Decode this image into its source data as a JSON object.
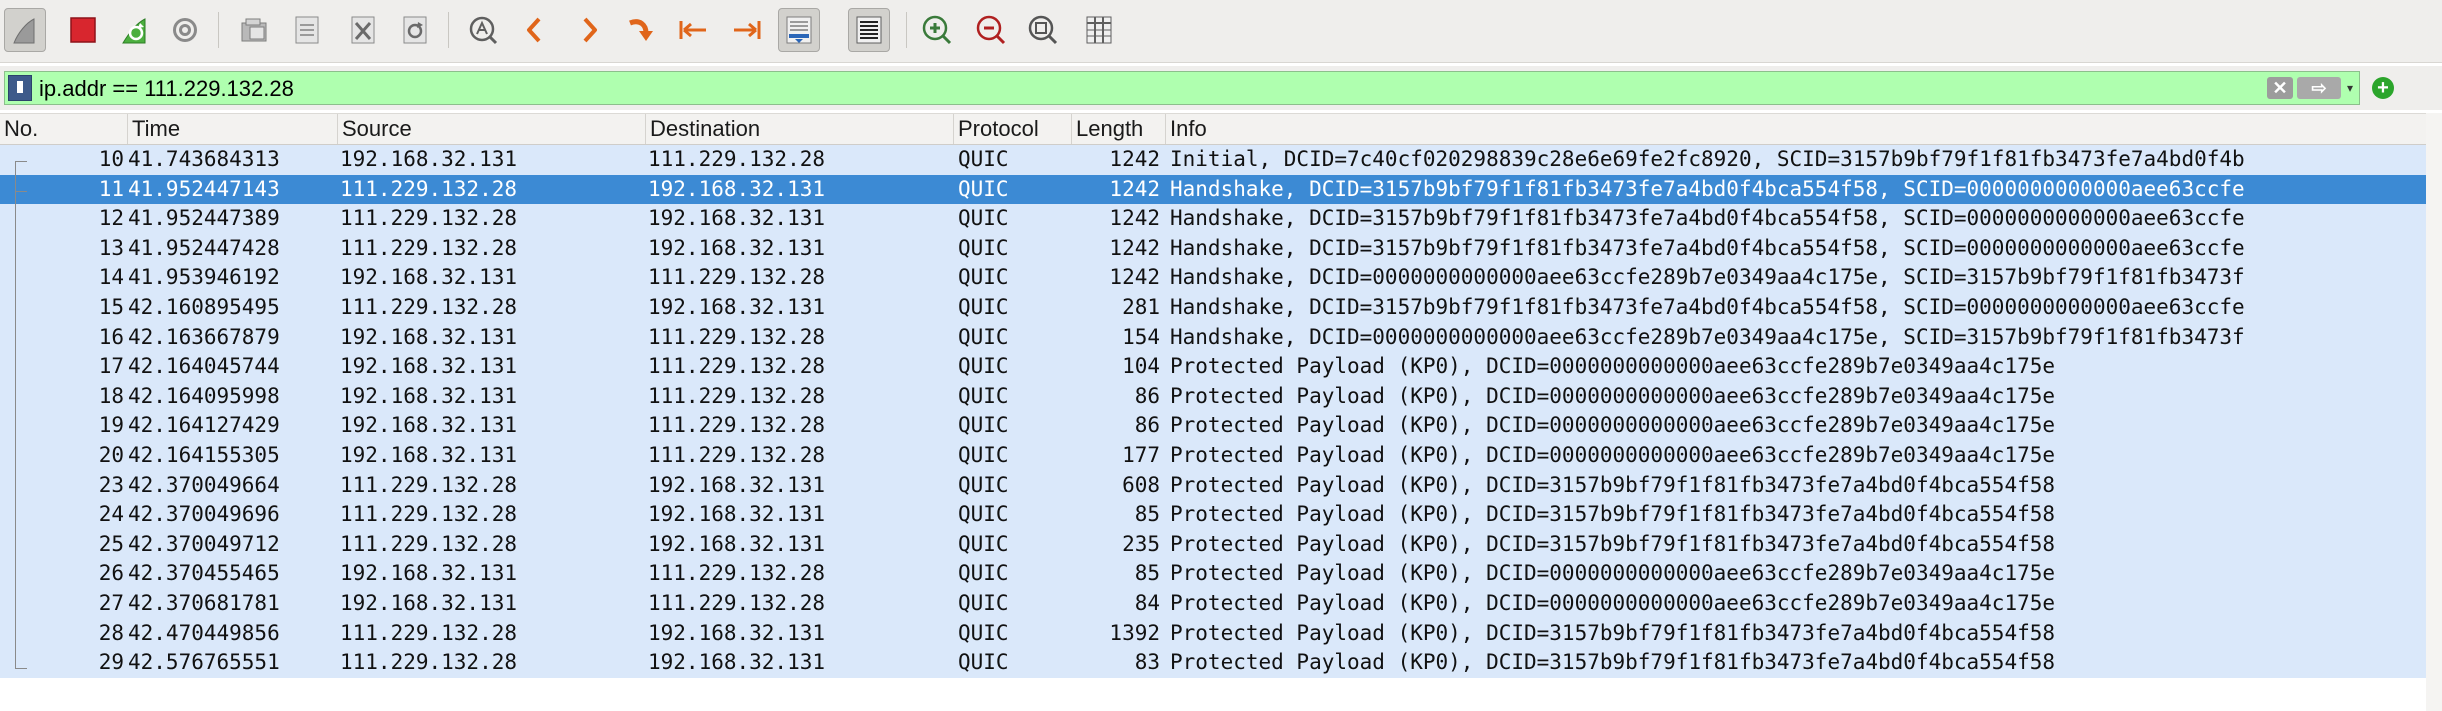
{
  "toolbar": {
    "buttons": [
      {
        "icon": "shark-fin-start-icon"
      },
      {
        "icon": "stop-square-icon"
      },
      {
        "icon": "restart-capture-icon"
      },
      {
        "icon": "capture-options-gear-icon"
      },
      {
        "icon": "open-file-icon"
      },
      {
        "icon": "save-file-icon"
      },
      {
        "icon": "close-file-icon"
      },
      {
        "icon": "reload-file-icon"
      },
      {
        "icon": "find-packet-icon"
      },
      {
        "icon": "go-back-arrow-icon"
      },
      {
        "icon": "go-forward-arrow-icon"
      },
      {
        "icon": "go-to-packet-icon"
      },
      {
        "icon": "go-first-packet-icon"
      },
      {
        "icon": "go-last-packet-icon"
      },
      {
        "icon": "auto-scroll-icon"
      },
      {
        "icon": "colorize-icon"
      },
      {
        "icon": "zoom-in-icon"
      },
      {
        "icon": "zoom-out-icon"
      },
      {
        "icon": "normal-size-icon"
      },
      {
        "icon": "resize-columns-icon"
      }
    ]
  },
  "filter": {
    "value": "ip.addr == 111.229.132.28",
    "clear_label": "✕",
    "apply_label": "⇨",
    "dropdown_label": "▾",
    "add_label": "+",
    "background": "#afffaf"
  },
  "columns": {
    "no": "No.",
    "time": "Time",
    "source": "Source",
    "destination": "Destination",
    "protocol": "Protocol",
    "length": "Length",
    "info": "Info"
  },
  "colors": {
    "row_bg": "#dae8fa",
    "selected_bg": "#3c8ad4"
  },
  "packets": [
    {
      "no": "10",
      "time": "41.743684313",
      "src": "192.168.32.131",
      "dst": "111.229.132.28",
      "proto": "QUIC",
      "len": "1242",
      "info": "Initial, DCID=7c40cf020298839c28e6e69fe2fc8920, SCID=3157b9bf79f1f81fb3473fe7a4bd0f4b",
      "selected": false
    },
    {
      "no": "11",
      "time": "41.952447143",
      "src": "111.229.132.28",
      "dst": "192.168.32.131",
      "proto": "QUIC",
      "len": "1242",
      "info": "Handshake, DCID=3157b9bf79f1f81fb3473fe7a4bd0f4bca554f58, SCID=0000000000000aee63ccfe",
      "selected": true
    },
    {
      "no": "12",
      "time": "41.952447389",
      "src": "111.229.132.28",
      "dst": "192.168.32.131",
      "proto": "QUIC",
      "len": "1242",
      "info": "Handshake, DCID=3157b9bf79f1f81fb3473fe7a4bd0f4bca554f58, SCID=0000000000000aee63ccfe",
      "selected": false
    },
    {
      "no": "13",
      "time": "41.952447428",
      "src": "111.229.132.28",
      "dst": "192.168.32.131",
      "proto": "QUIC",
      "len": "1242",
      "info": "Handshake, DCID=3157b9bf79f1f81fb3473fe7a4bd0f4bca554f58, SCID=0000000000000aee63ccfe",
      "selected": false
    },
    {
      "no": "14",
      "time": "41.953946192",
      "src": "192.168.32.131",
      "dst": "111.229.132.28",
      "proto": "QUIC",
      "len": "1242",
      "info": "Handshake, DCID=0000000000000aee63ccfe289b7e0349aa4c175e, SCID=3157b9bf79f1f81fb3473f",
      "selected": false
    },
    {
      "no": "15",
      "time": "42.160895495",
      "src": "111.229.132.28",
      "dst": "192.168.32.131",
      "proto": "QUIC",
      "len": "281",
      "info": "Handshake, DCID=3157b9bf79f1f81fb3473fe7a4bd0f4bca554f58, SCID=0000000000000aee63ccfe",
      "selected": false
    },
    {
      "no": "16",
      "time": "42.163667879",
      "src": "192.168.32.131",
      "dst": "111.229.132.28",
      "proto": "QUIC",
      "len": "154",
      "info": "Handshake, DCID=0000000000000aee63ccfe289b7e0349aa4c175e, SCID=3157b9bf79f1f81fb3473f",
      "selected": false
    },
    {
      "no": "17",
      "time": "42.164045744",
      "src": "192.168.32.131",
      "dst": "111.229.132.28",
      "proto": "QUIC",
      "len": "104",
      "info": "Protected Payload (KP0), DCID=0000000000000aee63ccfe289b7e0349aa4c175e",
      "selected": false
    },
    {
      "no": "18",
      "time": "42.164095998",
      "src": "192.168.32.131",
      "dst": "111.229.132.28",
      "proto": "QUIC",
      "len": "86",
      "info": "Protected Payload (KP0), DCID=0000000000000aee63ccfe289b7e0349aa4c175e",
      "selected": false
    },
    {
      "no": "19",
      "time": "42.164127429",
      "src": "192.168.32.131",
      "dst": "111.229.132.28",
      "proto": "QUIC",
      "len": "86",
      "info": "Protected Payload (KP0), DCID=0000000000000aee63ccfe289b7e0349aa4c175e",
      "selected": false
    },
    {
      "no": "20",
      "time": "42.164155305",
      "src": "192.168.32.131",
      "dst": "111.229.132.28",
      "proto": "QUIC",
      "len": "177",
      "info": "Protected Payload (KP0), DCID=0000000000000aee63ccfe289b7e0349aa4c175e",
      "selected": false
    },
    {
      "no": "23",
      "time": "42.370049664",
      "src": "111.229.132.28",
      "dst": "192.168.32.131",
      "proto": "QUIC",
      "len": "608",
      "info": "Protected Payload (KP0), DCID=3157b9bf79f1f81fb3473fe7a4bd0f4bca554f58",
      "selected": false
    },
    {
      "no": "24",
      "time": "42.370049696",
      "src": "111.229.132.28",
      "dst": "192.168.32.131",
      "proto": "QUIC",
      "len": "85",
      "info": "Protected Payload (KP0), DCID=3157b9bf79f1f81fb3473fe7a4bd0f4bca554f58",
      "selected": false
    },
    {
      "no": "25",
      "time": "42.370049712",
      "src": "111.229.132.28",
      "dst": "192.168.32.131",
      "proto": "QUIC",
      "len": "235",
      "info": "Protected Payload (KP0), DCID=3157b9bf79f1f81fb3473fe7a4bd0f4bca554f58",
      "selected": false
    },
    {
      "no": "26",
      "time": "42.370455465",
      "src": "192.168.32.131",
      "dst": "111.229.132.28",
      "proto": "QUIC",
      "len": "85",
      "info": "Protected Payload (KP0), DCID=0000000000000aee63ccfe289b7e0349aa4c175e",
      "selected": false
    },
    {
      "no": "27",
      "time": "42.370681781",
      "src": "192.168.32.131",
      "dst": "111.229.132.28",
      "proto": "QUIC",
      "len": "84",
      "info": "Protected Payload (KP0), DCID=0000000000000aee63ccfe289b7e0349aa4c175e",
      "selected": false
    },
    {
      "no": "28",
      "time": "42.470449856",
      "src": "111.229.132.28",
      "dst": "192.168.32.131",
      "proto": "QUIC",
      "len": "1392",
      "info": "Protected Payload (KP0), DCID=3157b9bf79f1f81fb3473fe7a4bd0f4bca554f58",
      "selected": false
    },
    {
      "no": "29",
      "time": "42.576765551",
      "src": "111.229.132.28",
      "dst": "192.168.32.131",
      "proto": "QUIC",
      "len": "83",
      "info": "Protected Payload (KP0), DCID=3157b9bf79f1f81fb3473fe7a4bd0f4bca554f58",
      "selected": false
    }
  ]
}
